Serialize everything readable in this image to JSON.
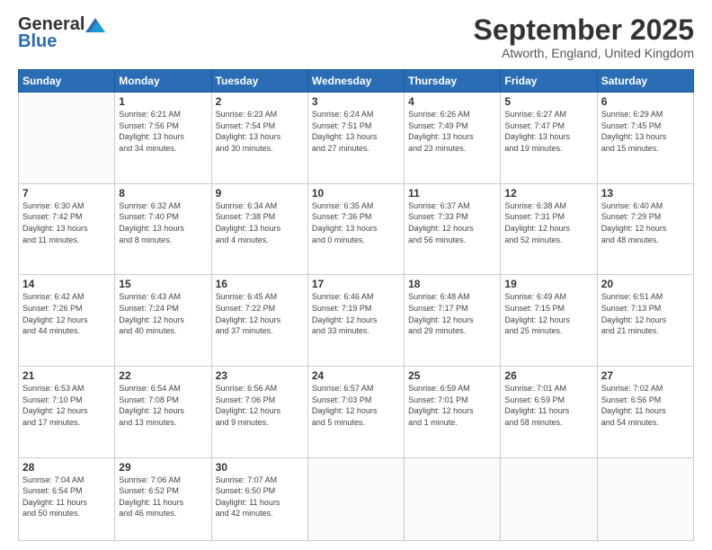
{
  "header": {
    "logo_general": "General",
    "logo_blue": "Blue",
    "month_title": "September 2025",
    "location": "Atworth, England, United Kingdom"
  },
  "days_of_week": [
    "Sunday",
    "Monday",
    "Tuesday",
    "Wednesday",
    "Thursday",
    "Friday",
    "Saturday"
  ],
  "weeks": [
    [
      {
        "num": "",
        "info": ""
      },
      {
        "num": "1",
        "info": "Sunrise: 6:21 AM\nSunset: 7:56 PM\nDaylight: 13 hours\nand 34 minutes."
      },
      {
        "num": "2",
        "info": "Sunrise: 6:23 AM\nSunset: 7:54 PM\nDaylight: 13 hours\nand 30 minutes."
      },
      {
        "num": "3",
        "info": "Sunrise: 6:24 AM\nSunset: 7:51 PM\nDaylight: 13 hours\nand 27 minutes."
      },
      {
        "num": "4",
        "info": "Sunrise: 6:26 AM\nSunset: 7:49 PM\nDaylight: 13 hours\nand 23 minutes."
      },
      {
        "num": "5",
        "info": "Sunrise: 6:27 AM\nSunset: 7:47 PM\nDaylight: 13 hours\nand 19 minutes."
      },
      {
        "num": "6",
        "info": "Sunrise: 6:29 AM\nSunset: 7:45 PM\nDaylight: 13 hours\nand 15 minutes."
      }
    ],
    [
      {
        "num": "7",
        "info": "Sunrise: 6:30 AM\nSunset: 7:42 PM\nDaylight: 13 hours\nand 11 minutes."
      },
      {
        "num": "8",
        "info": "Sunrise: 6:32 AM\nSunset: 7:40 PM\nDaylight: 13 hours\nand 8 minutes."
      },
      {
        "num": "9",
        "info": "Sunrise: 6:34 AM\nSunset: 7:38 PM\nDaylight: 13 hours\nand 4 minutes."
      },
      {
        "num": "10",
        "info": "Sunrise: 6:35 AM\nSunset: 7:36 PM\nDaylight: 13 hours\nand 0 minutes."
      },
      {
        "num": "11",
        "info": "Sunrise: 6:37 AM\nSunset: 7:33 PM\nDaylight: 12 hours\nand 56 minutes."
      },
      {
        "num": "12",
        "info": "Sunrise: 6:38 AM\nSunset: 7:31 PM\nDaylight: 12 hours\nand 52 minutes."
      },
      {
        "num": "13",
        "info": "Sunrise: 6:40 AM\nSunset: 7:29 PM\nDaylight: 12 hours\nand 48 minutes."
      }
    ],
    [
      {
        "num": "14",
        "info": "Sunrise: 6:42 AM\nSunset: 7:26 PM\nDaylight: 12 hours\nand 44 minutes."
      },
      {
        "num": "15",
        "info": "Sunrise: 6:43 AM\nSunset: 7:24 PM\nDaylight: 12 hours\nand 40 minutes."
      },
      {
        "num": "16",
        "info": "Sunrise: 6:45 AM\nSunset: 7:22 PM\nDaylight: 12 hours\nand 37 minutes."
      },
      {
        "num": "17",
        "info": "Sunrise: 6:46 AM\nSunset: 7:19 PM\nDaylight: 12 hours\nand 33 minutes."
      },
      {
        "num": "18",
        "info": "Sunrise: 6:48 AM\nSunset: 7:17 PM\nDaylight: 12 hours\nand 29 minutes."
      },
      {
        "num": "19",
        "info": "Sunrise: 6:49 AM\nSunset: 7:15 PM\nDaylight: 12 hours\nand 25 minutes."
      },
      {
        "num": "20",
        "info": "Sunrise: 6:51 AM\nSunset: 7:13 PM\nDaylight: 12 hours\nand 21 minutes."
      }
    ],
    [
      {
        "num": "21",
        "info": "Sunrise: 6:53 AM\nSunset: 7:10 PM\nDaylight: 12 hours\nand 17 minutes."
      },
      {
        "num": "22",
        "info": "Sunrise: 6:54 AM\nSunset: 7:08 PM\nDaylight: 12 hours\nand 13 minutes."
      },
      {
        "num": "23",
        "info": "Sunrise: 6:56 AM\nSunset: 7:06 PM\nDaylight: 12 hours\nand 9 minutes."
      },
      {
        "num": "24",
        "info": "Sunrise: 6:57 AM\nSunset: 7:03 PM\nDaylight: 12 hours\nand 5 minutes."
      },
      {
        "num": "25",
        "info": "Sunrise: 6:59 AM\nSunset: 7:01 PM\nDaylight: 12 hours\nand 1 minute."
      },
      {
        "num": "26",
        "info": "Sunrise: 7:01 AM\nSunset: 6:59 PM\nDaylight: 11 hours\nand 58 minutes."
      },
      {
        "num": "27",
        "info": "Sunrise: 7:02 AM\nSunset: 6:56 PM\nDaylight: 11 hours\nand 54 minutes."
      }
    ],
    [
      {
        "num": "28",
        "info": "Sunrise: 7:04 AM\nSunset: 6:54 PM\nDaylight: 11 hours\nand 50 minutes."
      },
      {
        "num": "29",
        "info": "Sunrise: 7:06 AM\nSunset: 6:52 PM\nDaylight: 11 hours\nand 46 minutes."
      },
      {
        "num": "30",
        "info": "Sunrise: 7:07 AM\nSunset: 6:50 PM\nDaylight: 11 hours\nand 42 minutes."
      },
      {
        "num": "",
        "info": ""
      },
      {
        "num": "",
        "info": ""
      },
      {
        "num": "",
        "info": ""
      },
      {
        "num": "",
        "info": ""
      }
    ]
  ]
}
